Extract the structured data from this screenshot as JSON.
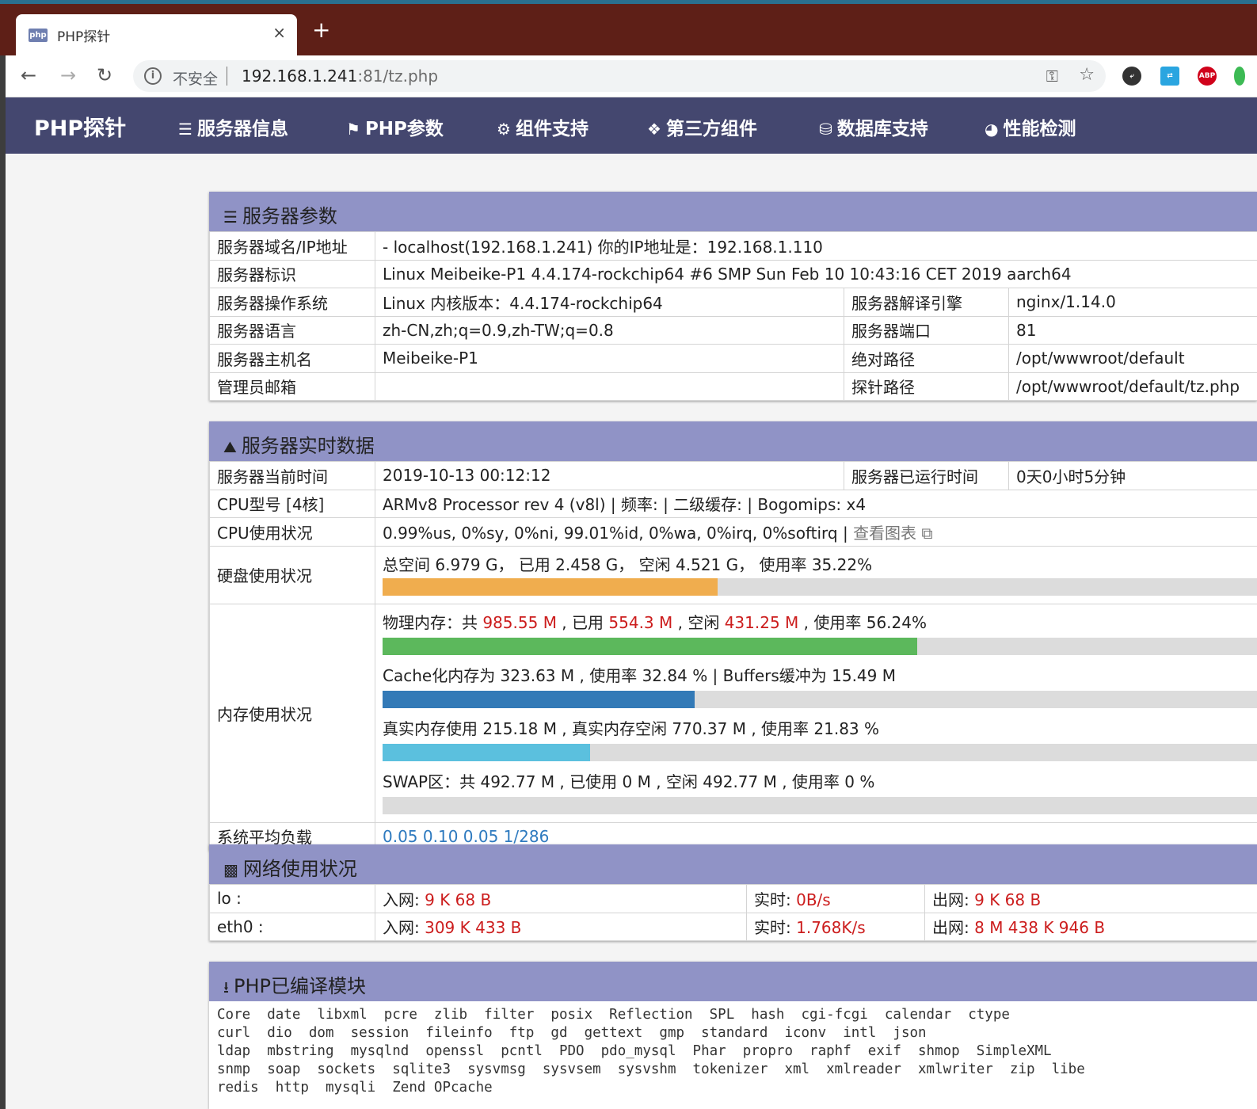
{
  "browser": {
    "tab_title": "PHP探针",
    "favicon_text": "php",
    "close_glyph": "×",
    "newtab_glyph": "+",
    "insecure_label": "不安全",
    "url_host": "192.168.1.241",
    "url_port_path": ":81/tz.php",
    "ext_abp": "ABP"
  },
  "nav": {
    "brand": "PHP探针",
    "items": [
      "服务器信息",
      "PHP参数",
      "组件支持",
      "第三方组件",
      "数据库支持",
      "性能检测"
    ]
  },
  "server_params": {
    "title": "服务器参数",
    "domain_label": "服务器域名/IP地址",
    "domain_value": "- localhost(192.168.1.241)  你的IP地址是：192.168.1.110",
    "id_label": "服务器标识",
    "id_value": "Linux Meibeike-P1 4.4.174-rockchip64 #6 SMP Sun Feb 10 10:43:16 CET 2019 aarch64",
    "os_label": "服务器操作系统",
    "os_value": "Linux  内核版本：4.4.174-rockchip64",
    "engine_label": "服务器解译引擎",
    "engine_value": "nginx/1.14.0",
    "lang_label": "服务器语言",
    "lang_value": "zh-CN,zh;q=0.9,zh-TW;q=0.8",
    "port_label": "服务器端口",
    "port_value": "81",
    "host_label": "服务器主机名",
    "host_value": "Meibeike-P1",
    "abs_label": "绝对路径",
    "abs_value": "/opt/wwwroot/default",
    "admin_label": "管理员邮箱",
    "admin_value": "",
    "probe_label": "探针路径",
    "probe_value": "/opt/wwwroot/default/tz.php"
  },
  "realtime": {
    "title": "服务器实时数据",
    "time_label": "服务器当前时间",
    "time_value": "2019-10-13 00:12:12",
    "uptime_label": "服务器已运行时间",
    "uptime_value": "0天0小时5分钟",
    "cpu_label": "CPU型号 [4核]",
    "cpu_value": "ARMv8 Processor rev 4 (v8l) | 频率: | 二级缓存: | Bogomips: x4",
    "cpu_usage_label": "CPU使用状况",
    "cpu_usage_value": "0.99%us, 0%sy, 0%ni, 99.01%id, 0%wa, 0%irq, 0%softirq | ",
    "chart_link": "查看图表",
    "disk_label": "硬盘使用状况",
    "disk_text": "总空间 6.979 G，  已用 2.458 G，  空闲 4.521 G，  使用率 35.22%",
    "disk_pct": 35.22,
    "mem_label": "内存使用状况",
    "phys_prefix": "物理内存：共 ",
    "phys_total": "985.55 M",
    "phys_used_prefix": " , 已用 ",
    "phys_used": "554.3 M",
    "phys_free_prefix": " , 空闲 ",
    "phys_free": "431.25 M",
    "phys_rate": " , 使用率 56.24%",
    "phys_pct": 56.24,
    "cache_text": "Cache化内存为 323.63 M , 使用率 32.84 % | Buffers缓冲为 15.49 M",
    "cache_pct": 32.84,
    "real_text": "真实内存使用 215.18 M , 真实内存空闲 770.37 M , 使用率 21.83 %",
    "real_pct": 21.83,
    "swap_text": "SWAP区：共 492.77 M , 已使用 0 M , 空闲 492.77 M , 使用率 0 %",
    "swap_pct": 0,
    "load_label": "系统平均负载",
    "load_value": "0.05 0.10 0.05 1/286",
    "colors": {
      "disk": "#f0ad4e",
      "phys": "#5cb85c",
      "cache": "#337ab7",
      "real": "#5bc0de"
    }
  },
  "network": {
    "title": "网络使用状况",
    "rows": [
      {
        "name": "lo :",
        "in_label": "入网: ",
        "in": "9 K 68 B",
        "rt_label": "实时: ",
        "rt": "0B/s",
        "out_label": "出网: ",
        "out": "9 K 68 B"
      },
      {
        "name": "eth0 :",
        "in_label": "入网: ",
        "in": "309 K 433 B",
        "rt_label": "实时: ",
        "rt": "1.768K/s",
        "out_label": "出网: ",
        "out": "8 M 438 K 946 B"
      }
    ]
  },
  "modules": {
    "title": "PHP已编译模块",
    "lines": [
      "Core  date  libxml  pcre  zlib  filter  posix  Reflection  SPL  hash  cgi-fcgi  calendar  ctype",
      "curl  dio  dom  session  fileinfo  ftp  gd  gettext  gmp  standard  iconv  intl  json",
      "ldap  mbstring  mysqlnd  openssl  pcntl  PDO  pdo_mysql  Phar  propro  raphf  exif  shmop  SimpleXML",
      "snmp  soap  sockets  sqlite3  sysvmsg  sysvsem  sysvshm  tokenizer  xml  xmlreader  xmlwriter  zip  libe",
      "redis  http  mysqli  Zend OPcache"
    ]
  }
}
